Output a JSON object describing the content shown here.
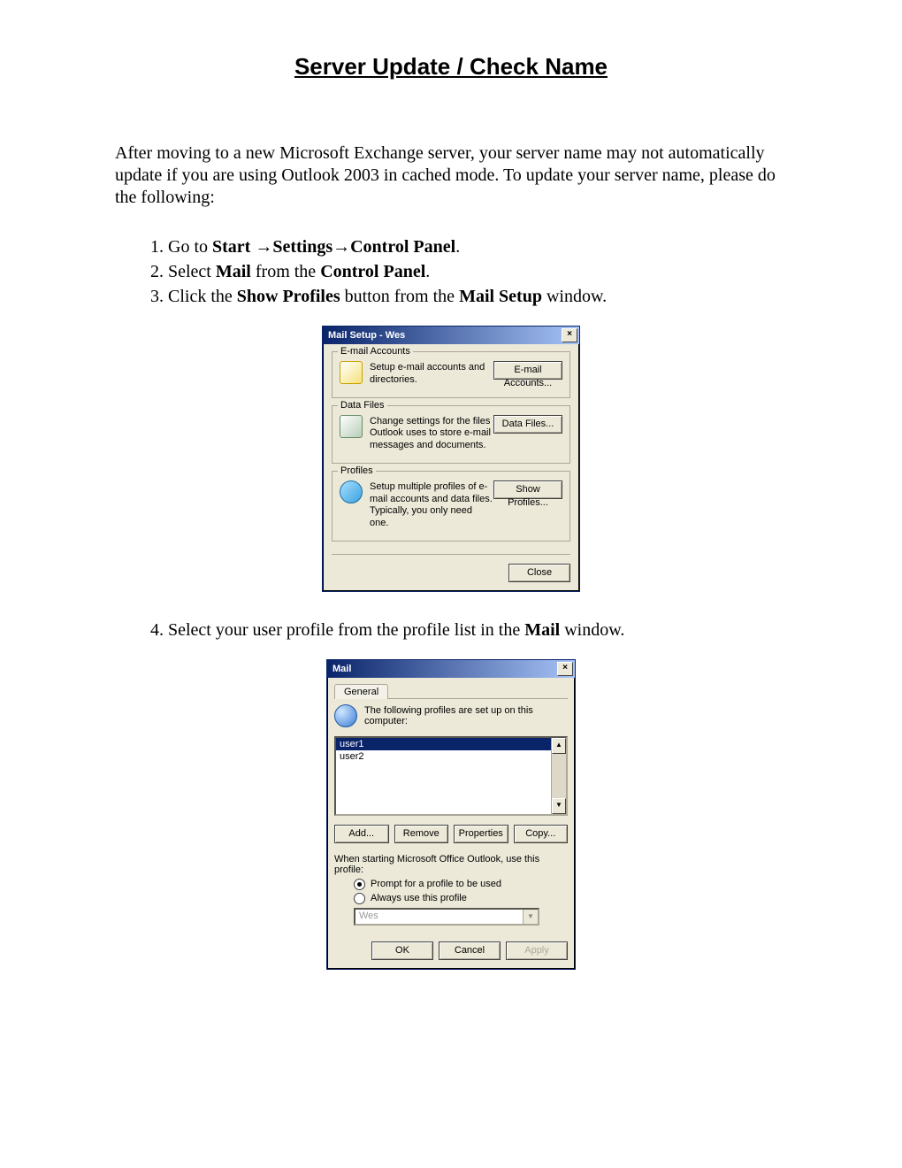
{
  "title": "Server Update / Check Name",
  "intro": "After moving to a new Microsoft Exchange server, your server name may not automatically update if you are using Outlook 2003 in cached mode. To update your server name, please do the following:",
  "steps": {
    "s1_pre": "Go to ",
    "s1_bold": "Start →Settings→Control Panel",
    "s1_post": ".",
    "s2_a": "Select ",
    "s2_b": "Mail",
    "s2_c": " from the ",
    "s2_d": "Control Panel",
    "s2_e": ".",
    "s3_a": "Click the ",
    "s3_b": "Show Profiles",
    "s3_c": " button from the ",
    "s3_d": "Mail Setup",
    "s3_e": " window.",
    "s4_a": "Select your user profile from the profile list in the ",
    "s4_b": "Mail",
    "s4_c": " window."
  },
  "mailSetup": {
    "title": "Mail Setup - Wes",
    "close_x": "×",
    "groups": {
      "email": {
        "legend": "E-mail Accounts",
        "text": "Setup e-mail accounts and directories.",
        "button": "E-mail Accounts..."
      },
      "data": {
        "legend": "Data Files",
        "text": "Change settings for the files Outlook uses to store e-mail messages and documents.",
        "button": "Data Files..."
      },
      "prof": {
        "legend": "Profiles",
        "text": "Setup multiple profiles of e-mail accounts and data files. Typically, you only need one.",
        "button": "Show Profiles..."
      }
    },
    "closeBtn": "Close"
  },
  "mailDlg": {
    "title": "Mail",
    "close_x": "×",
    "tab": "General",
    "info": "The following profiles are set up on this computer:",
    "profiles": [
      "user1",
      "user2"
    ],
    "selectedIndex": 0,
    "buttons": {
      "add": "Add...",
      "remove": "Remove",
      "props": "Properties",
      "copy": "Copy..."
    },
    "startupText": "When starting Microsoft Office Outlook, use this profile:",
    "radioPrompt": "Prompt for a profile to be used",
    "radioAlways": "Always use this profile",
    "radioSelected": "prompt",
    "comboValue": "Wes",
    "footer": {
      "ok": "OK",
      "cancel": "Cancel",
      "apply": "Apply"
    },
    "scroll": {
      "up": "▲",
      "down": "▼"
    },
    "comboArrow": "▼"
  }
}
